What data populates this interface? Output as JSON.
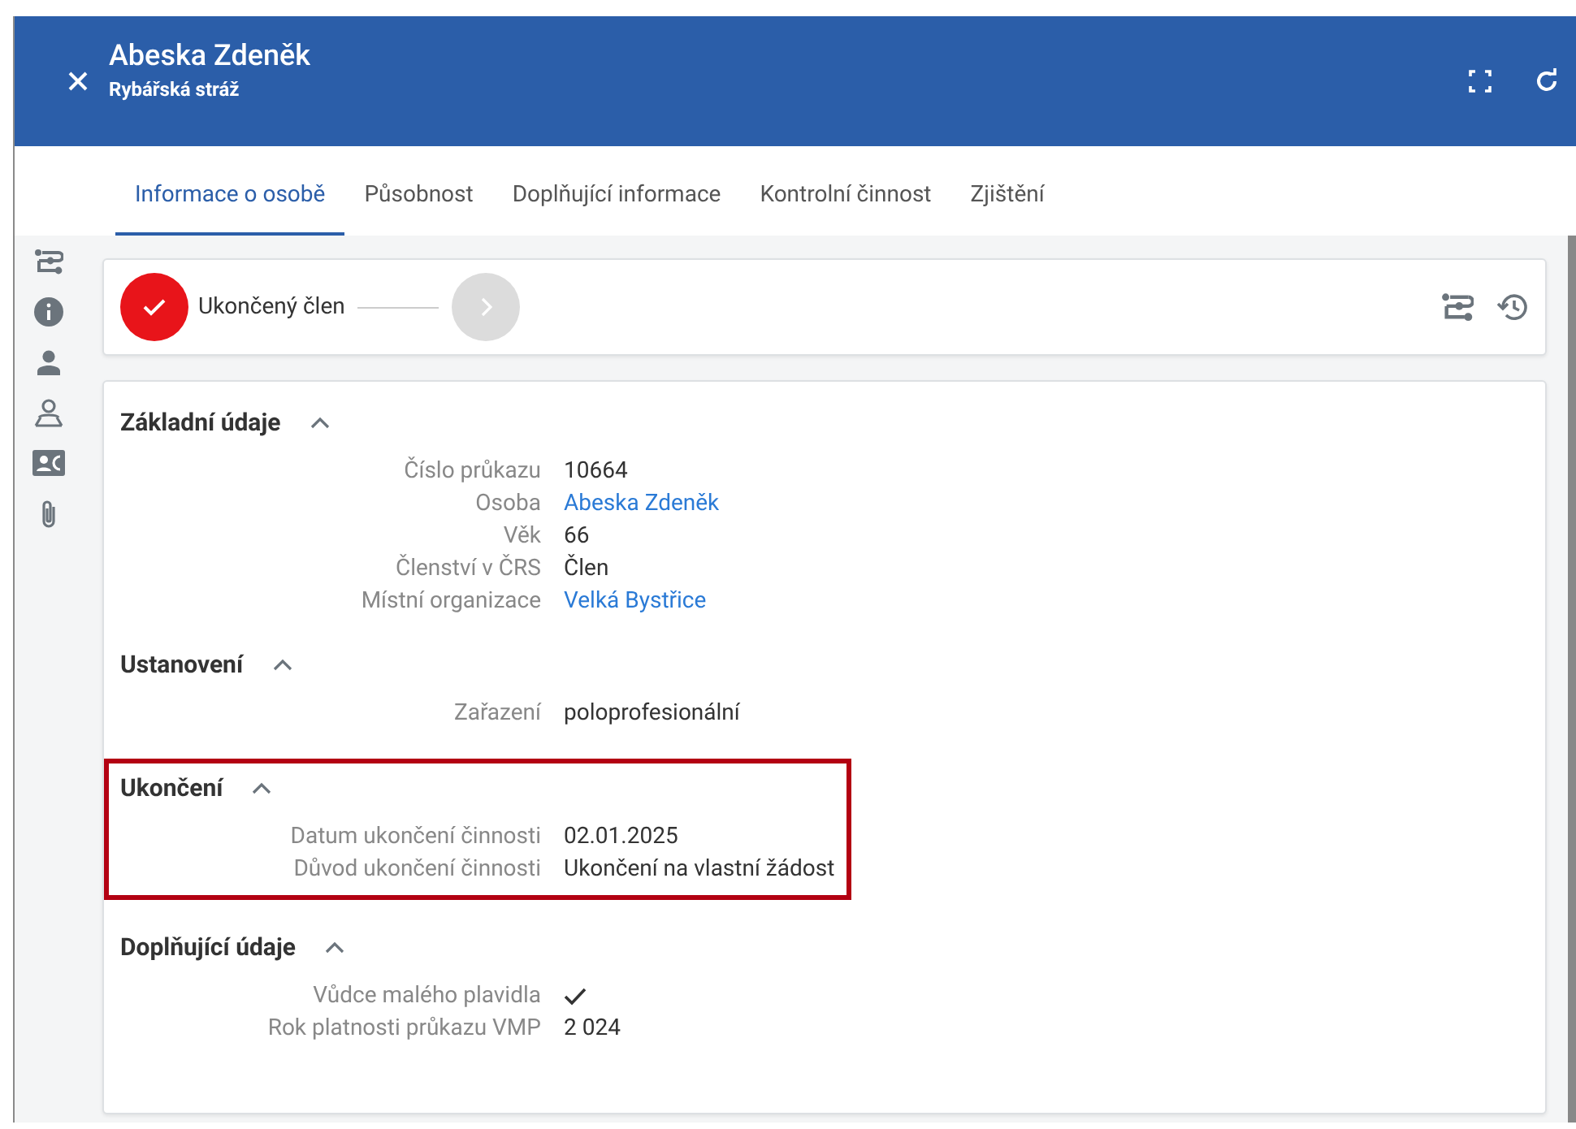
{
  "window": {
    "title": "Abeska Zdeněk",
    "subtitle": "Rybářská stráž"
  },
  "tabs": [
    {
      "label": "Informace o osobě",
      "selected": true
    },
    {
      "label": "Působnost",
      "selected": false
    },
    {
      "label": "Doplňující informace",
      "selected": false
    },
    {
      "label": "Kontrolní činnost",
      "selected": false
    },
    {
      "label": "Zjištění",
      "selected": false
    }
  ],
  "stepper": {
    "steps": [
      {
        "label": "Ukončený člen",
        "done": true
      },
      {
        "done": false
      }
    ]
  },
  "sections": [
    {
      "title": "Základní údaje",
      "expanded": true,
      "highlighted": false,
      "rows": [
        {
          "label": "Číslo průkazu",
          "value": "10664",
          "kind": "text"
        },
        {
          "label": "Osoba",
          "value": "Abeska Zdeněk",
          "kind": "link"
        },
        {
          "label": "Věk",
          "value": "66",
          "kind": "text"
        },
        {
          "label": "Členství v ČRS",
          "value": "Člen",
          "kind": "text"
        },
        {
          "label": "Místní organizace",
          "value": "Velká Bystřice",
          "kind": "link"
        }
      ]
    },
    {
      "title": "Ustanovení",
      "expanded": true,
      "highlighted": false,
      "rows": [
        {
          "label": "Zařazení",
          "value": "poloprofesionální",
          "kind": "text"
        }
      ]
    },
    {
      "title": "Ukončení",
      "expanded": true,
      "highlighted": true,
      "rows": [
        {
          "label": "Datum ukončení činnosti",
          "value": "02.01.2025",
          "kind": "text"
        },
        {
          "label": "Důvod ukončení činnosti",
          "value": "Ukončení na vlastní žádost",
          "kind": "text"
        }
      ]
    },
    {
      "title": "Doplňující údaje",
      "expanded": true,
      "highlighted": false,
      "rows": [
        {
          "label": "Vůdce malého plavidla",
          "checked": true,
          "kind": "check"
        },
        {
          "label": "Rok platnosti průkazu VMP",
          "value": "2 024",
          "kind": "text"
        }
      ]
    }
  ]
}
